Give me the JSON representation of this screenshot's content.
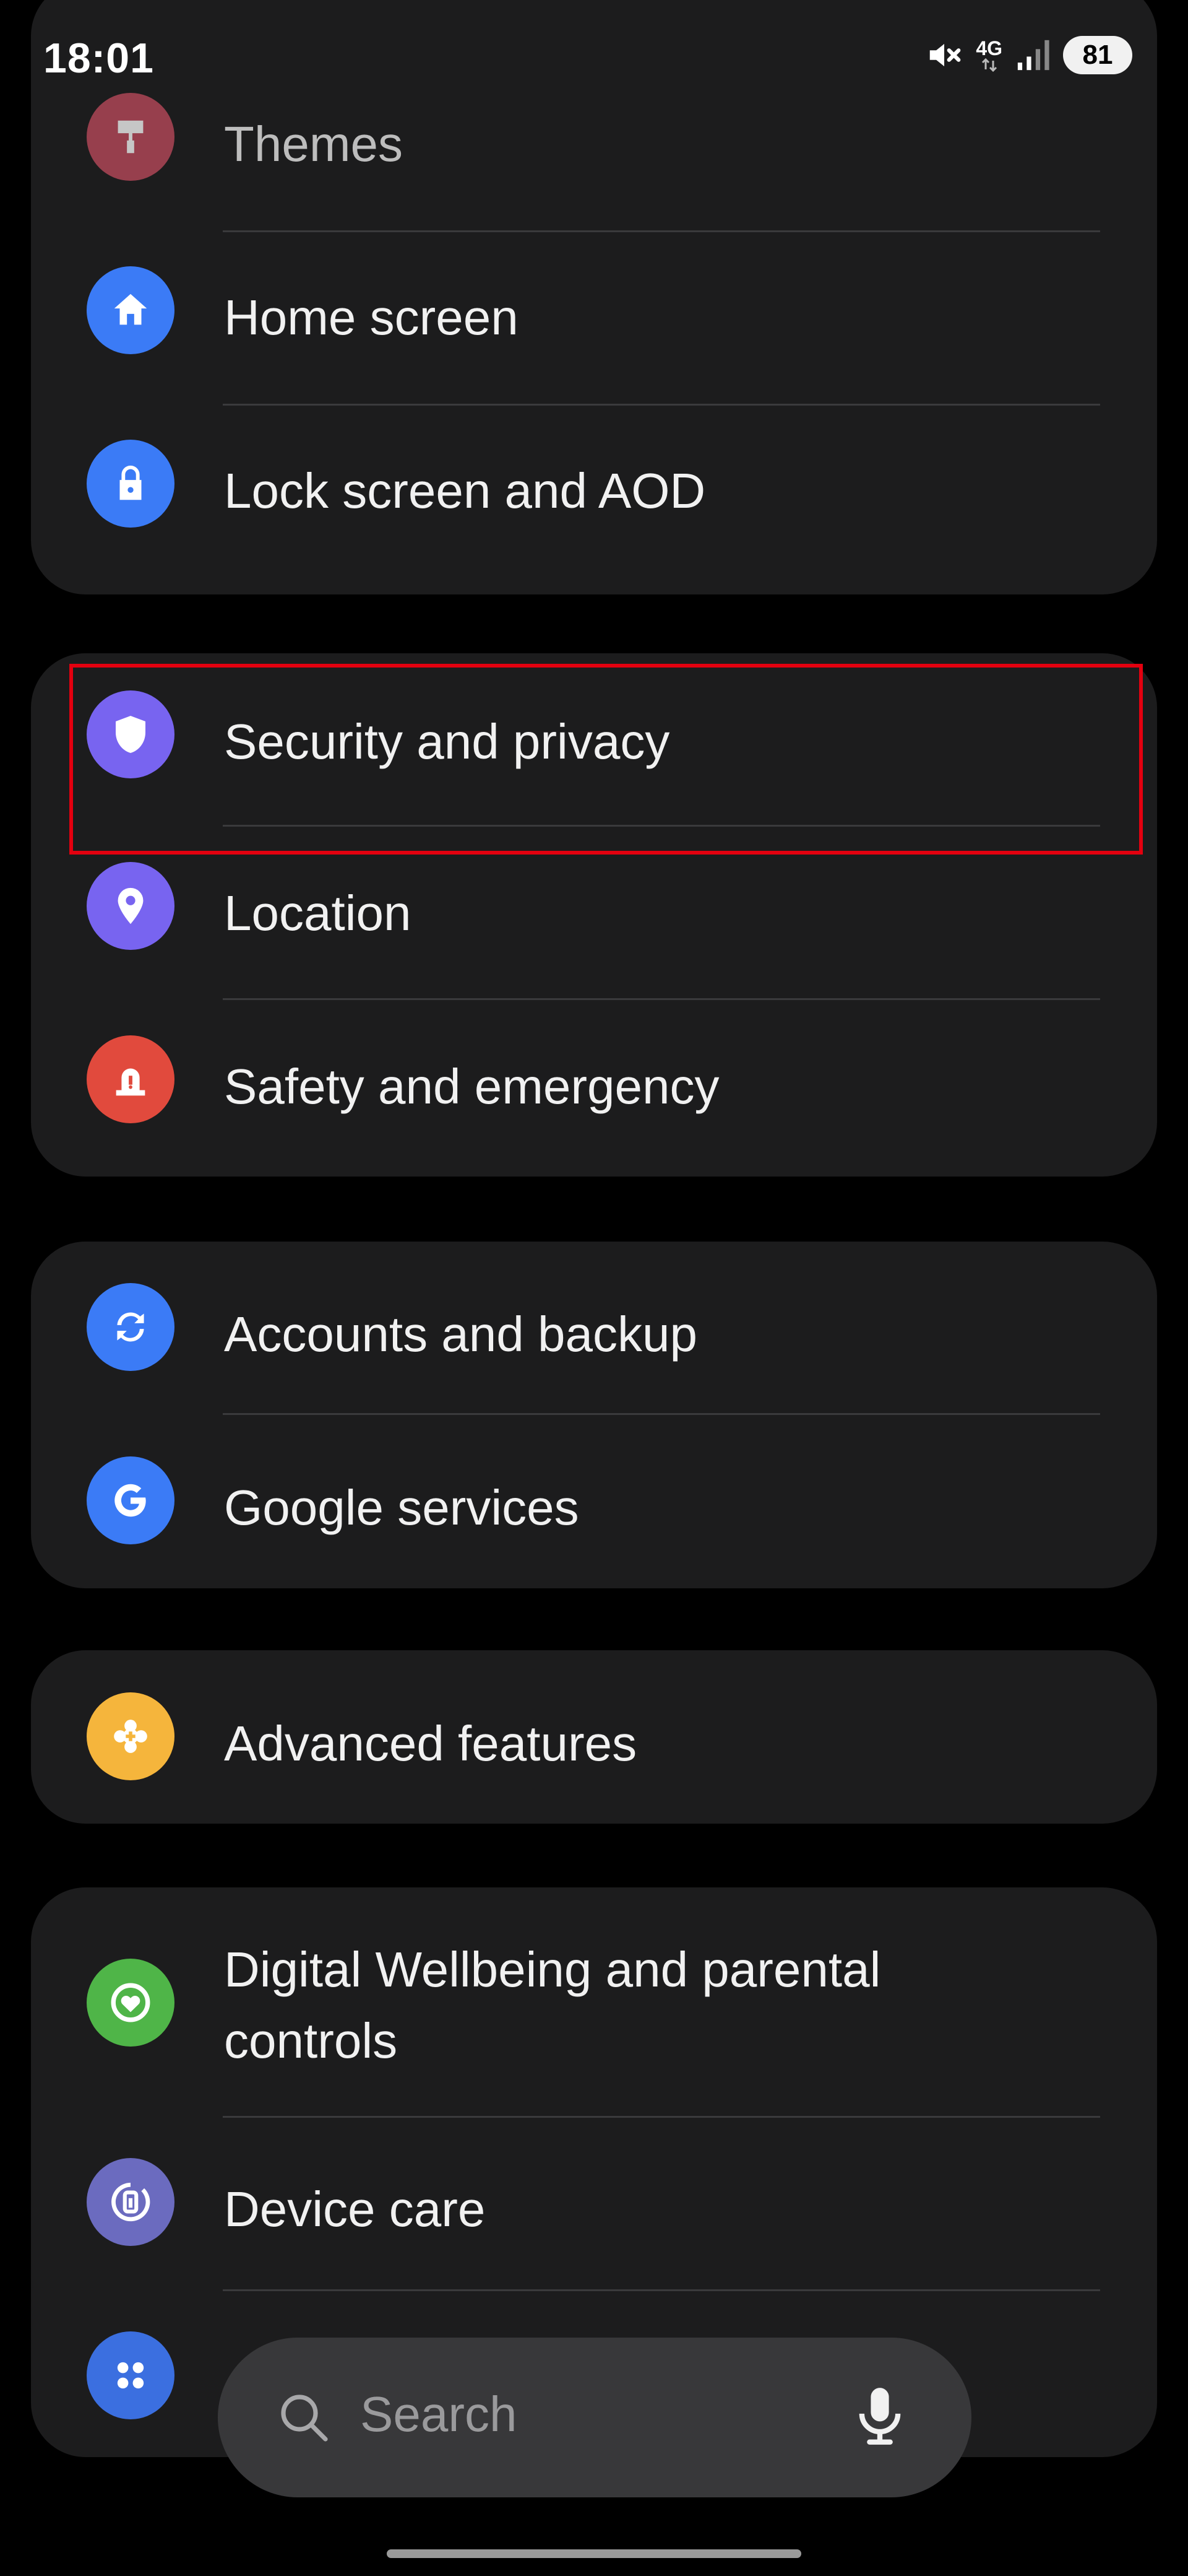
{
  "status_bar": {
    "time": "18:01",
    "network": "4G",
    "battery": "81",
    "icons": [
      "mute-icon",
      "4g-data-icon",
      "signal-icon",
      "battery-icon"
    ]
  },
  "groups": [
    {
      "items": [
        {
          "label": "Themes",
          "icon": "themes-icon",
          "color": "#c04b5d"
        },
        {
          "label": "Home screen",
          "icon": "home-icon",
          "color": "#3b7bf6"
        },
        {
          "label": "Lock screen and AOD",
          "icon": "lock-icon",
          "color": "#3b7bf6"
        }
      ]
    },
    {
      "items": [
        {
          "label": "Security and privacy",
          "icon": "shield-icon",
          "color": "#7864f0"
        },
        {
          "label": "Location",
          "icon": "location-pin-icon",
          "color": "#7864f0"
        },
        {
          "label": "Safety and emergency",
          "icon": "emergency-siren-icon",
          "color": "#e14a3d"
        }
      ]
    },
    {
      "items": [
        {
          "label": "Accounts and backup",
          "icon": "sync-icon",
          "color": "#3b7bf6"
        },
        {
          "label": "Google services",
          "icon": "google-g-icon",
          "color": "#3b7bf6"
        }
      ]
    },
    {
      "items": [
        {
          "label": "Advanced features",
          "icon": "puzzle-gear-icon",
          "color": "#f5b53c"
        }
      ]
    },
    {
      "items": [
        {
          "label": "Digital Wellbeing and parental controls",
          "icon": "wellbeing-heart-icon",
          "color": "#4fb548"
        },
        {
          "label": "Device care",
          "icon": "device-care-icon",
          "color": "#6b6bbf"
        },
        {
          "label": "",
          "icon": "apps-grid-icon",
          "color": "#3b6fe0"
        }
      ]
    }
  ],
  "highlight": {
    "target": "Security and privacy",
    "color": "#e3000f"
  },
  "search": {
    "placeholder": "Search",
    "icons": [
      "search-icon",
      "microphone-icon"
    ]
  }
}
